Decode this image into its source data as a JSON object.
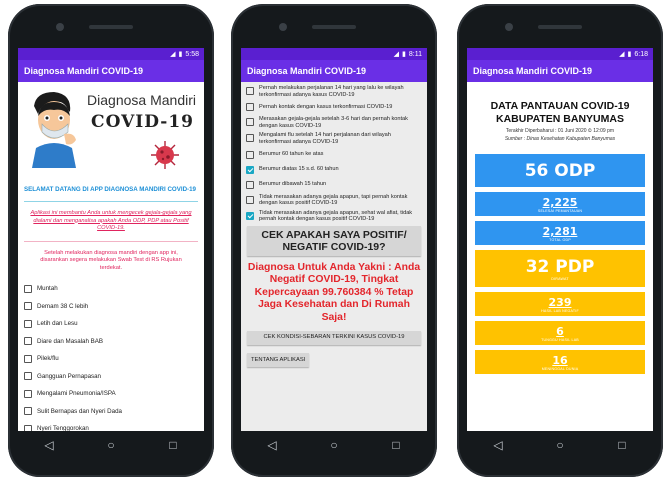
{
  "screens": {
    "s1": {
      "status_time": "5:58",
      "app_title": "Diagnosa Mandiri COVID-19",
      "hero_title1": "Diagnosa Mandiri",
      "hero_title2": "COVID-19",
      "welcome": "SELAMAT DATANG DI APP DIAGNOSA MANDIRI COVID-19",
      "info1": "Aplikasi ini membantu Anda untuk mengecek gejala-gejala yang dialami dan menganalisa apakah Anda ODP, PDP atau Positif COVID-19.",
      "info2": "Setelah melakukan diagnosa mandiri dengan app ini, disarankan segera melakukan Swab Test di RS Rujukan terdekat.",
      "symptoms": [
        "Muntah",
        "Demam 38 C lebih",
        "Letih dan Lesu",
        "Diare dan Masalah BAB",
        "Pilek/flu",
        "Gangguan Pernapasan",
        "Mengalami Pneumonia/ISPA",
        "Sulit Bernapas dan Nyeri Dada",
        "Nyeri Tenggorokan"
      ]
    },
    "s2": {
      "status_time": "8:11",
      "app_title": "Diagnosa Mandiri COVID-19",
      "items": [
        {
          "label": "Pernah melakukan perjalanan 14 hari yang lalu ke wilayah terkonfirmasi adanya kasus COVID-19",
          "checked": false
        },
        {
          "label": "Pernah kontak dengan kasus terkonfirmasi COVID-19",
          "checked": false
        },
        {
          "label": "Merasakan gejala-gejala setelah 3-6 hari dan pernah kontak dengan kasus COVID-19",
          "checked": false
        },
        {
          "label": "Mengalami flu setelah 14 hari perjalanan dari wilayah terkonfirmasi adanya COVID-19",
          "checked": false
        },
        {
          "label": "Berumur 60 tahun ke atas",
          "checked": false
        },
        {
          "label": "Berumur diatas 15 s.d. 60 tahun",
          "checked": true
        },
        {
          "label": "Berumur dibawah 15 tahun",
          "checked": false
        },
        {
          "label": "Tidak merasakan adanya gejala apapun, tapi pernah kontak dengan kasus positif COVID-19",
          "checked": false
        },
        {
          "label": "Tidak merasakan adanya gejala apapun, sehat wal afiat, tidak pernah kontak dengan kasus positif COVID-19",
          "checked": true
        }
      ],
      "check_button": "CEK APAKAH SAYA POSITIF/ NEGATIF COVID-19?",
      "result": "Diagnosa Untuk Anda Yakni : Anda Negatif COVID-19, Tingkat Kepercayaan 99.760384 % Tetap Jaga Kesehatan dan Di Rumah Saja!",
      "condition_button": "CEK KONDISI-SEBARAN TERKINI KASUS COVID-19",
      "about_button": "TENTANG APLIKASI"
    },
    "s3": {
      "status_time": "6:18",
      "app_title": "Diagnosa Mandiri COVID-19",
      "heading": "DATA PANTAUAN COVID-19 KABUPATEN BANYUMAS",
      "updated": "Terakhir Diperbaharui : 01 Juni 2020 ⏲ 12:09 pm",
      "source": "Sumber : Dinas Kesehatan Kabupaten Banyumas",
      "stats": [
        {
          "value": "56 ODP",
          "label": "",
          "color": "blue",
          "size": "big"
        },
        {
          "value": "2,225",
          "label": "SELESAI PEMANTAUAN",
          "color": "blue",
          "size": "small"
        },
        {
          "value": "2,281",
          "label": "TOTAL ODP",
          "color": "blue",
          "size": "small"
        },
        {
          "value": "32 PDP",
          "label": "DIRAWAT",
          "color": "yellow",
          "size": "big"
        },
        {
          "value": "239",
          "label": "HASIL LAB NEGATIF",
          "color": "yellow",
          "size": "small"
        },
        {
          "value": "6",
          "label": "TUNGGU HASIL LAB",
          "color": "yellow",
          "size": "small"
        },
        {
          "value": "16",
          "label": "MENINGGAL DUNIA",
          "color": "yellow",
          "size": "small"
        }
      ]
    }
  },
  "nav": {
    "back": "◁",
    "home": "○",
    "recent": "□"
  },
  "colors": {
    "appbar": "#6a2fe6",
    "statusbar": "#5a1fd0",
    "blue": "#2f95f0",
    "yellow": "#ffc200",
    "result_red": "#e3262c",
    "pink": "#e0245e"
  }
}
